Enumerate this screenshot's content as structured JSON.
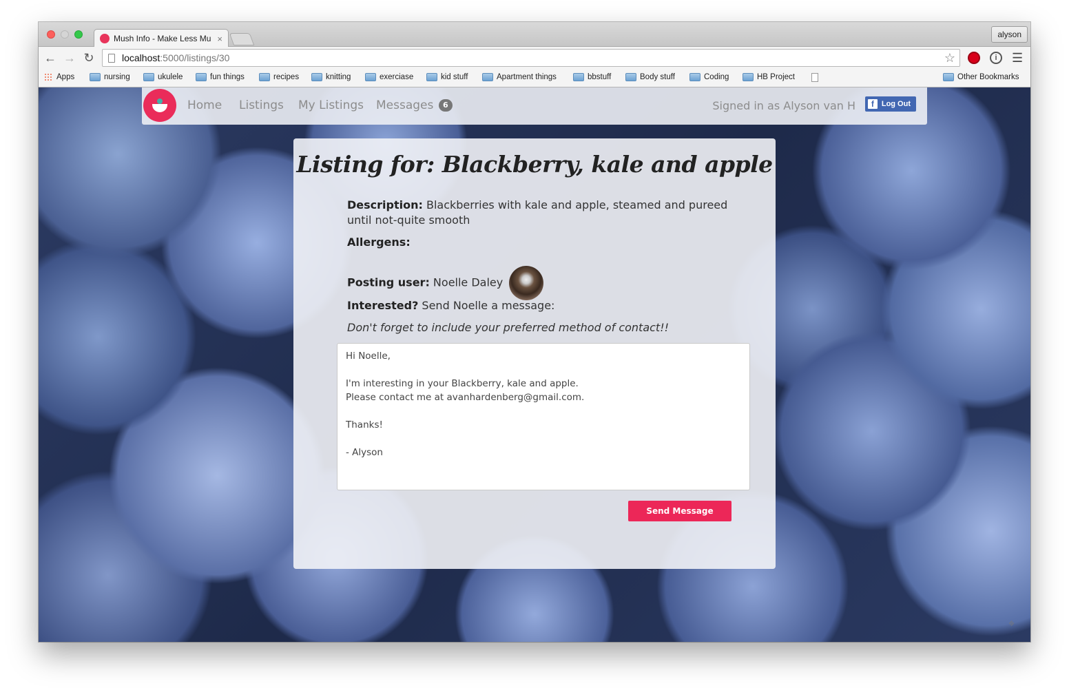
{
  "browser": {
    "tab_title": "Mush Info - Make Less Mu",
    "tab_close": "×",
    "profile": "alyson",
    "url_host": "localhost",
    "url_path": ":5000/listings/30",
    "bookmarks": [
      "Apps",
      "nursing",
      "ukulele",
      "fun things",
      "recipes",
      "knitting",
      "exerciase",
      "kid stuff",
      "Apartment things",
      "bbstuff",
      "Body stuff",
      "Coding",
      "HB Project"
    ],
    "other_bookmarks": "Other Bookmarks"
  },
  "nav": {
    "links": [
      "Home",
      "Listings",
      "My Listings",
      "Messages"
    ],
    "messages_count": "6",
    "signed_in": "Signed in as Alyson van H",
    "logout": "Log Out",
    "fb_glyph": "f"
  },
  "listing": {
    "title": "Listing for: Blackberry, kale and apple",
    "description_label": "Description:",
    "description": " Blackberries with kale and apple, steamed and pureed until not-quite smooth",
    "allergens_label": "Allergens:",
    "posting_label": "Posting user:",
    "posting_user": " Noelle Daley",
    "interested_label": "Interested?",
    "interested_text": " Send Noelle a message:",
    "reminder": "Don't forget to include your preferred method of contact!!",
    "message": "Hi Noelle,\n\nI'm interesting in your Blackberry, kale and apple.\nPlease contact me at avanhardenberg@gmail.com.\n\nThanks!\n\n- Alyson",
    "send_label": "Send Message"
  },
  "colors": {
    "brand": "#ea2c5a",
    "facebook": "#4267b2",
    "send_button": "#ec2758"
  }
}
